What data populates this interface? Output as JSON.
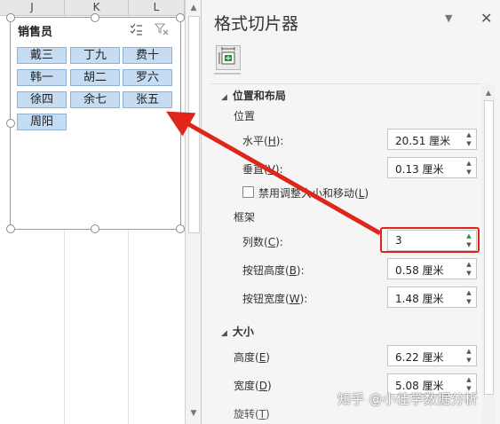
{
  "sheet": {
    "columns": [
      "J",
      "K",
      "L"
    ]
  },
  "slicer": {
    "title": "销售员",
    "items": [
      [
        "戴三",
        "丁九",
        "费十"
      ],
      [
        "韩一",
        "胡二",
        "罗六"
      ],
      [
        "徐四",
        "余七",
        "张五"
      ],
      [
        "周阳"
      ]
    ]
  },
  "pane": {
    "title": "格式切片器",
    "section_position": "位置和布局",
    "group_position": "位置",
    "horizontal_label": "水平(",
    "horizontal_key": "H",
    "horizontal_close": "):",
    "horizontal_value": "20.51 厘米",
    "vertical_label": "垂直(",
    "vertical_key": "V",
    "vertical_close": "):",
    "vertical_value": "0.13 厘米",
    "disable_resize_label": "禁用调整大小和移动(",
    "disable_resize_key": "L",
    "disable_resize_close": ")",
    "group_frame": "框架",
    "columns_label": "列数(",
    "columns_key": "C",
    "columns_close": "):",
    "columns_value": "3",
    "btn_height_label": "按钮高度(",
    "btn_height_key": "B",
    "btn_height_close": "):",
    "btn_height_value": "0.58 厘米",
    "btn_width_label": "按钮宽度(",
    "btn_width_key": "W",
    "btn_width_close": "):",
    "btn_width_value": "1.48 厘米",
    "section_size": "大小",
    "height_label": "高度(",
    "height_key": "E",
    "height_close": ")",
    "height_value": "6.22 厘米",
    "width_label": "宽度(",
    "width_key": "D",
    "width_close": ")",
    "width_value": "5.08 厘米",
    "rotate_label": "旋转(",
    "rotate_key": "T",
    "rotate_close": ")"
  },
  "watermark": "知乎 @小佳学数据分析",
  "colors": {
    "slicer_button": "#c6dcf2",
    "annotation_red": "#e0251b",
    "pane_bg": "#f5f5f5",
    "icon_green": "#2e8b3c"
  }
}
